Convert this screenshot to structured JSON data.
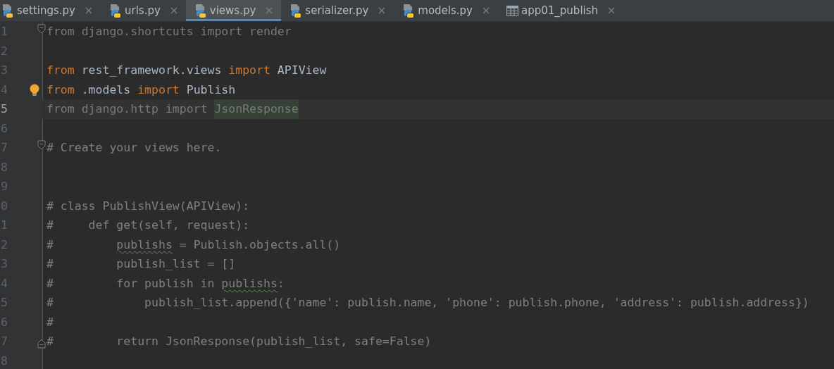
{
  "tabs": [
    {
      "label": "settings.py",
      "kind": "python",
      "selected": false
    },
    {
      "label": "urls.py",
      "kind": "python",
      "selected": false
    },
    {
      "label": "views.py",
      "kind": "python",
      "selected": true
    },
    {
      "label": "serializer.py",
      "kind": "python",
      "selected": false
    },
    {
      "label": "models.py",
      "kind": "python",
      "selected": false
    },
    {
      "label": "app01_publish",
      "kind": "table",
      "selected": false
    }
  ],
  "lines": [
    {
      "number": "1",
      "current": false,
      "fold_start": true,
      "tokens": [
        {
          "text": "from django.shortcuts import render",
          "kind": "unused"
        }
      ]
    },
    {
      "number": "2",
      "current": false
    },
    {
      "number": "3",
      "current": false,
      "tokens": [
        {
          "text": "from",
          "kind": "keyword"
        },
        {
          "text": " rest_framework.views ",
          "kind": "plain"
        },
        {
          "text": "import",
          "kind": "keyword"
        },
        {
          "text": " APIView",
          "kind": "plain"
        }
      ]
    },
    {
      "number": "4",
      "current": false,
      "intention": true,
      "tokens": [
        {
          "text": "from",
          "kind": "keyword"
        },
        {
          "text": " .models ",
          "kind": "plain"
        },
        {
          "text": "import",
          "kind": "keyword"
        },
        {
          "text": " Publish",
          "kind": "plain"
        }
      ]
    },
    {
      "number": "5",
      "current": true,
      "tokens": [
        {
          "text": "from django.http import ",
          "kind": "unused"
        },
        {
          "text": "JsonResponse",
          "kind": "unused-highlight"
        }
      ]
    },
    {
      "number": "6",
      "current": false
    },
    {
      "number": "7",
      "current": false,
      "fold_start": true,
      "tokens": [
        {
          "text": "# Create your views here.",
          "kind": "comment"
        }
      ]
    },
    {
      "number": "8",
      "current": false
    },
    {
      "number": "9",
      "current": false
    },
    {
      "number": "0",
      "current": false,
      "tokens": [
        {
          "text": "# class PublishView(APIView):",
          "kind": "comment"
        }
      ]
    },
    {
      "number": "1",
      "current": false,
      "tokens": [
        {
          "text": "#     def get(self, request):",
          "kind": "comment"
        }
      ]
    },
    {
      "number": "2",
      "current": false,
      "tokens": [
        {
          "text": "#         ",
          "kind": "comment"
        },
        {
          "text": "publishs",
          "kind": "typo"
        },
        {
          "text": " = Publish.objects.all()",
          "kind": "comment"
        }
      ]
    },
    {
      "number": "3",
      "current": false,
      "tokens": [
        {
          "text": "#         publish_list = []",
          "kind": "comment"
        }
      ]
    },
    {
      "number": "4",
      "current": false,
      "tokens": [
        {
          "text": "#         for publish in ",
          "kind": "comment"
        },
        {
          "text": "publishs",
          "kind": "typo"
        },
        {
          "text": ":",
          "kind": "comment"
        }
      ]
    },
    {
      "number": "5",
      "current": false,
      "tokens": [
        {
          "text": "#             publish_list.append({'name': publish.name, 'phone': publish.phone, 'address': publish.address})",
          "kind": "comment"
        }
      ]
    },
    {
      "number": "6",
      "current": false,
      "tokens": [
        {
          "text": "#",
          "kind": "comment"
        }
      ]
    },
    {
      "number": "7",
      "current": false,
      "fold_end": true,
      "tokens": [
        {
          "text": "#         return JsonResponse(publish_list, safe=False)",
          "kind": "comment"
        }
      ]
    },
    {
      "number": "8",
      "current": false
    }
  ]
}
